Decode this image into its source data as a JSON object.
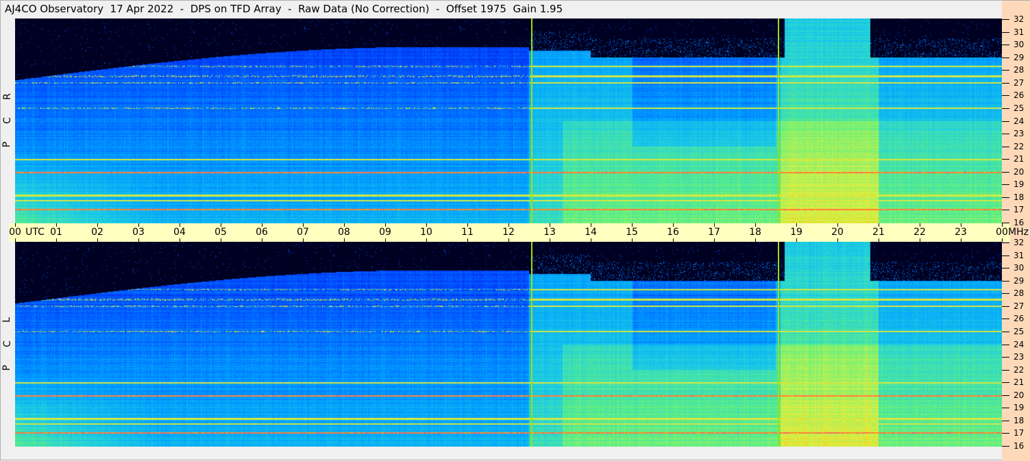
{
  "title": "AJ4CO Observatory  17 Apr 2022  -  DPS on TFD Array  -  Raw Data (No Correction)  -  Offset 1975  Gain 1.95",
  "chart_data": {
    "type": "heatmap",
    "title": "AJ4CO Observatory  17 Apr 2022  -  DPS on TFD Array  -  Raw Data (No Correction)  -  Offset 1975  Gain 1.95",
    "xlabel": "UTC",
    "ylabel": "MHz",
    "xlim": [
      0,
      24
    ],
    "ylim": [
      16,
      32
    ],
    "x_ticks": [
      "00",
      "01",
      "02",
      "03",
      "04",
      "05",
      "06",
      "07",
      "08",
      "09",
      "10",
      "11",
      "12",
      "13",
      "14",
      "15",
      "16",
      "17",
      "18",
      "19",
      "20",
      "21",
      "22",
      "23",
      "00"
    ],
    "y_ticks": [
      16,
      17,
      18,
      19,
      20,
      21,
      22,
      23,
      24,
      25,
      26,
      27,
      28,
      29,
      30,
      31,
      32
    ],
    "panels": [
      {
        "name": "RCP",
        "letters": [
          "R",
          "C",
          "P"
        ]
      },
      {
        "name": "LCP",
        "letters": [
          "L",
          "C",
          "P"
        ]
      }
    ],
    "time_markers_utc": [
      12.55,
      18.55
    ],
    "interference_lines_mhz": [
      17.1,
      17.8,
      18.2,
      20.0,
      21.0,
      25.0,
      27.0,
      27.5,
      28.3
    ],
    "colormap": [
      "#000000",
      "#00008c",
      "#0040ff",
      "#00a0ff",
      "#20d0e0",
      "#60f080",
      "#e0f040",
      "#ffa000",
      "#ff00ff"
    ]
  }
}
